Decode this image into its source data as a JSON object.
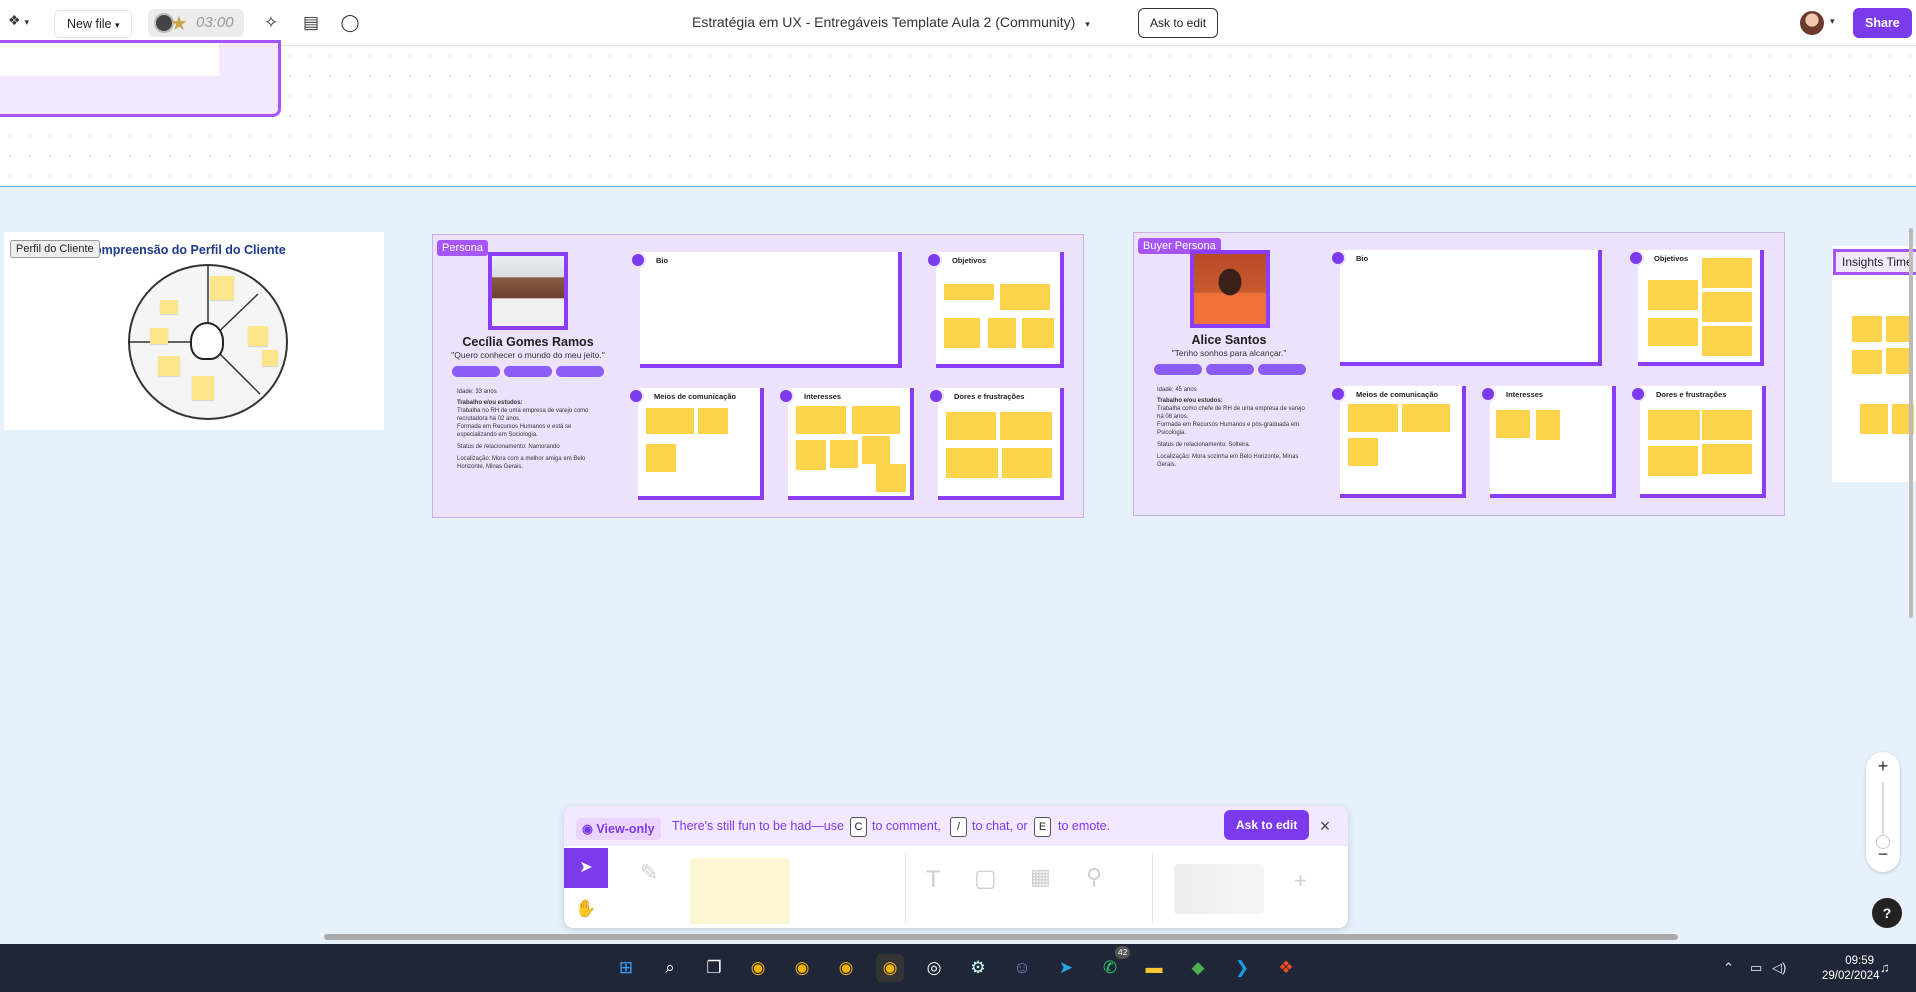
{
  "topbar": {
    "new_file_label": "New file",
    "timer": "03:00",
    "doc_title": "Estratégia em UX - Entregáveis Template Aula 2 (Community)",
    "ask_to_edit": "Ask to edit",
    "share": "Share"
  },
  "canvas": {
    "perfil": {
      "label": "Perfil do Cliente",
      "title": "ompreensão do Perfil do Cliente"
    },
    "persona": {
      "label": "Persona",
      "name": "Cecília Gomes Ramos",
      "quote": "\"Quero conhecer o mundo do meu jeito.\"",
      "age": "Idade: 33 anos",
      "work_heading": "Trabalho e/ou estudos:",
      "work_items": [
        "Trabalha no RH de uma empresa de varejo como recrutadora há 02 anos.",
        "Formada em Recursos Humanos e está se especializando em Sociologia."
      ],
      "relationship": "Status de relacionamento: Namorando",
      "location": "Localização: Mora com a melhor amiga em Belo Horizonte, Minas Gerais.",
      "cards": {
        "bio": "Bio",
        "objetivos": "Objetivos",
        "meios": "Meios de comunicação",
        "interesses": "Interesses",
        "dores": "Dores e frustrações"
      }
    },
    "buyer": {
      "label": "Buyer Persona",
      "name": "Alice Santos",
      "quote": "\"Tenho sonhos para alcançar.\"",
      "age": "Idade: 45 anos",
      "work_heading": "Trabalho e/ou estudos:",
      "work_items": [
        "Trabalha como chefe de RH de uma empresa de varejo há 08 anos.",
        "Formada em Recursos Humanos e pós-graduada em Psicologia."
      ],
      "relationship": "Status de relacionamento: Solteira.",
      "location": "Localização: Mora sozinha em Belo Horizonte, Minas Gerais.",
      "cards": {
        "bio": "Bio",
        "objetivos": "Objetivos",
        "meios": "Meios de comunicação",
        "interesses": "Interesses",
        "dores": "Dores e frustrações"
      }
    },
    "insights": {
      "label": "Insights Time"
    }
  },
  "toolbar": {
    "view_only": "View-only",
    "msg_1": "There's still fun to be had—use",
    "key_c": "C",
    "msg_2": "to comment,",
    "key_slash": "/",
    "msg_3": "to chat, or",
    "key_e": "E",
    "msg_4": "to emote.",
    "ask_to_edit": "Ask to edit"
  },
  "taskbar": {
    "time": "09:59",
    "date": "29/02/2024",
    "whatsapp_badge": "42"
  },
  "colors": {
    "accent": "#7c3aed",
    "canvas_bg": "#e6f1fc",
    "sticky": "#fcd34d",
    "board": "#ede2fb"
  }
}
